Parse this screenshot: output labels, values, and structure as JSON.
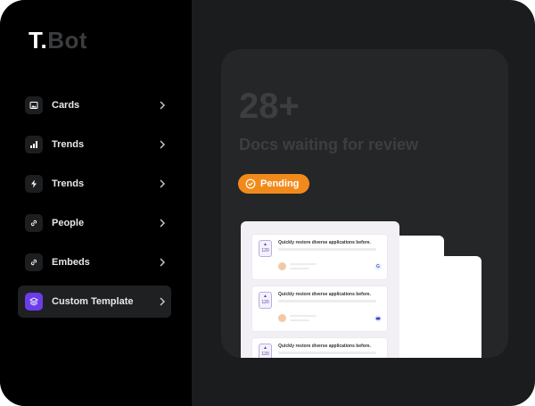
{
  "brand": {
    "prefix": "T.",
    "suffix": "Bot"
  },
  "sidebar": {
    "items": [
      {
        "label": "Cards"
      },
      {
        "label": "Trends"
      },
      {
        "label": "Trends"
      },
      {
        "label": "People"
      },
      {
        "label": "Embeds"
      },
      {
        "label": "Custom Template",
        "active": true
      }
    ]
  },
  "stats": {
    "count": "28+",
    "subtitle": "Docs waiting for review",
    "status": "Pending"
  },
  "documents": [
    {
      "title": "Quickly restore diverse applications before.",
      "votes": "120",
      "badge": "G"
    },
    {
      "title": "Quickly restore diverse applications before.",
      "votes": "120",
      "badge": ""
    },
    {
      "title": "Quickly restore diverse applications before.",
      "votes": "120",
      "badge": ""
    }
  ],
  "colors": {
    "accent": "#6a3de8",
    "pending": "#f28a1b",
    "sidebar": "#000000",
    "panel": "#252628"
  }
}
